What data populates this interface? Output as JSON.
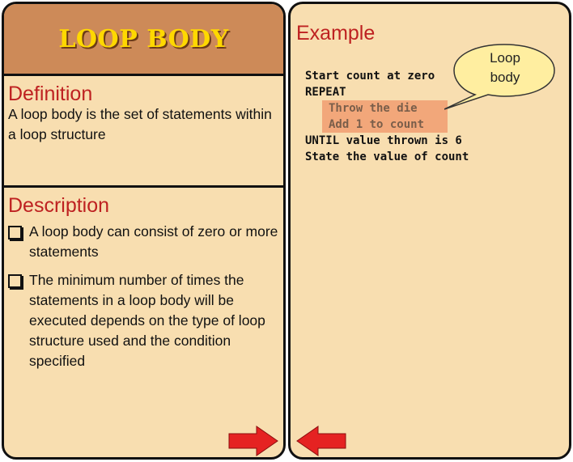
{
  "left": {
    "title": "LOOP BODY",
    "definition": {
      "heading": "Definition",
      "text": "A loop body is the set of statements within a loop structure"
    },
    "description": {
      "heading": "Description",
      "bullets": [
        "A loop body can consist of zero or more statements",
        "The minimum number of times the statements in a loop body will be executed depends on the type of loop structure used and the condition specified"
      ]
    }
  },
  "right": {
    "heading": "Example",
    "code": {
      "line1": "Start count at zero",
      "line2": "REPEAT",
      "line3": "Throw the die",
      "line4": "Add 1 to count",
      "line5": "UNTIL value thrown is 6",
      "line6": "State the value of count"
    },
    "callout": {
      "line1": "Loop",
      "line2": "body"
    }
  },
  "nav": {
    "next_icon": "right-arrow-icon",
    "prev_icon": "left-arrow-icon",
    "arrow_color": "#e52222"
  },
  "colors": {
    "card_bg": "#f8deb0",
    "title_bg": "#cd8a58",
    "title_text": "#ffd800",
    "heading_red": "#be2121",
    "highlight": "#f2a77a",
    "callout_fill": "#ffeea0"
  }
}
